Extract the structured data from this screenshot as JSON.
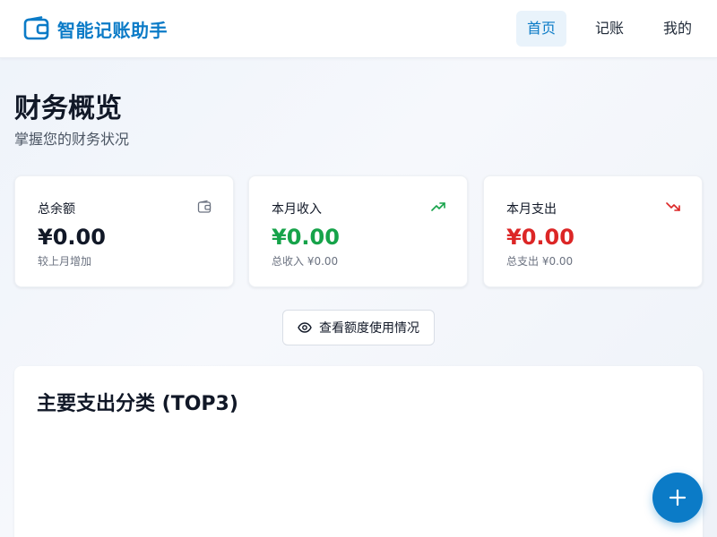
{
  "app": {
    "name": "智能记账助手",
    "brand_icon": "wallet-icon",
    "accent_color": "#0b7bc7"
  },
  "nav": {
    "items": [
      {
        "label": "首页",
        "active": true
      },
      {
        "label": "记账",
        "active": false
      },
      {
        "label": "我的",
        "active": false
      }
    ]
  },
  "page": {
    "title": "财务概览",
    "subtitle": "掌握您的财务状况"
  },
  "cards": {
    "balance": {
      "label": "总余额",
      "value": "¥0.00",
      "sub": "较上月增加",
      "icon": "wallet-icon",
      "color": "#111827"
    },
    "income": {
      "label": "本月收入",
      "value": "¥0.00",
      "sub": "总收入 ¥0.00",
      "icon": "trending-up-icon",
      "color": "#16a34a"
    },
    "expense": {
      "label": "本月支出",
      "value": "¥0.00",
      "sub": "总支出 ¥0.00",
      "icon": "trending-down-icon",
      "color": "#dc2626"
    }
  },
  "quota_button": {
    "label": "查看额度使用情况",
    "icon": "eye-icon"
  },
  "category_panel": {
    "title": "主要支出分类 (TOP3)"
  },
  "fab": {
    "icon": "plus-icon"
  }
}
